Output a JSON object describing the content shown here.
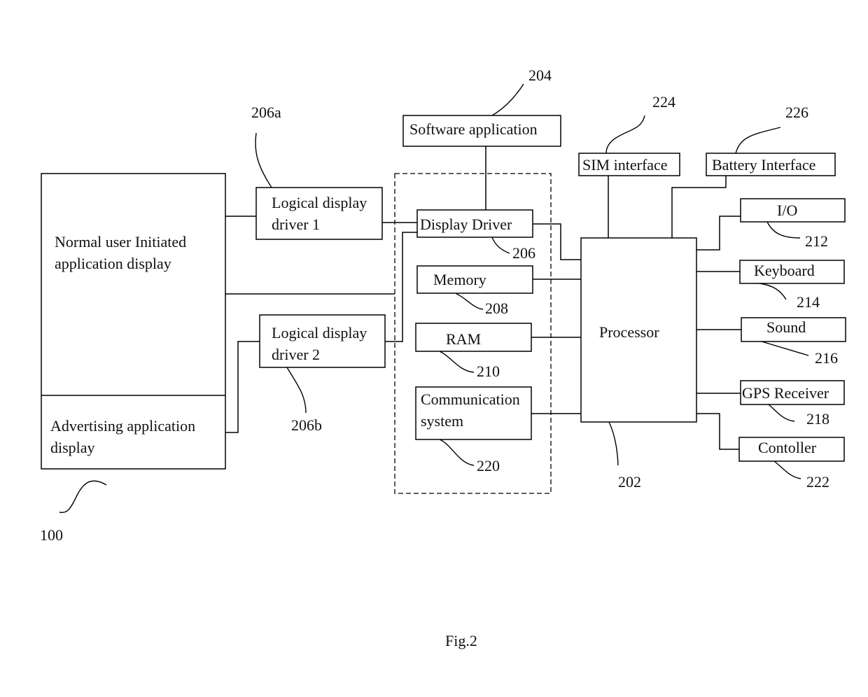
{
  "figure": {
    "caption": "Fig.2",
    "device_ref": "100"
  },
  "display": {
    "normal_line1": "Normal user Initiated",
    "normal_line2": "application display",
    "ad_line1": "Advertising application",
    "ad_line2": "display"
  },
  "blocks": {
    "ldd1_line1": "Logical display",
    "ldd1_line2": "driver 1",
    "ldd1_ref": "206a",
    "ldd2_line1": "Logical display",
    "ldd2_line2": "driver 2",
    "ldd2_ref": "206b",
    "software": "Software application",
    "software_ref": "204",
    "display_driver": "Display Driver",
    "display_driver_ref": "206",
    "memory": "Memory",
    "memory_ref": "208",
    "ram": "RAM",
    "ram_ref": "210",
    "comm_line1": "Communication",
    "comm_line2": "system",
    "comm_ref": "220",
    "processor": "Processor",
    "processor_ref": "202",
    "sim": "SIM interface",
    "sim_ref": "224",
    "battery": "Battery Interface",
    "battery_ref": "226",
    "io": "I/O",
    "io_ref": "212",
    "keyboard": "Keyboard",
    "keyboard_ref": "214",
    "sound": "Sound",
    "sound_ref": "216",
    "gps": "GPS Receiver",
    "gps_ref": "218",
    "controller": "Contoller",
    "controller_ref": "222"
  }
}
